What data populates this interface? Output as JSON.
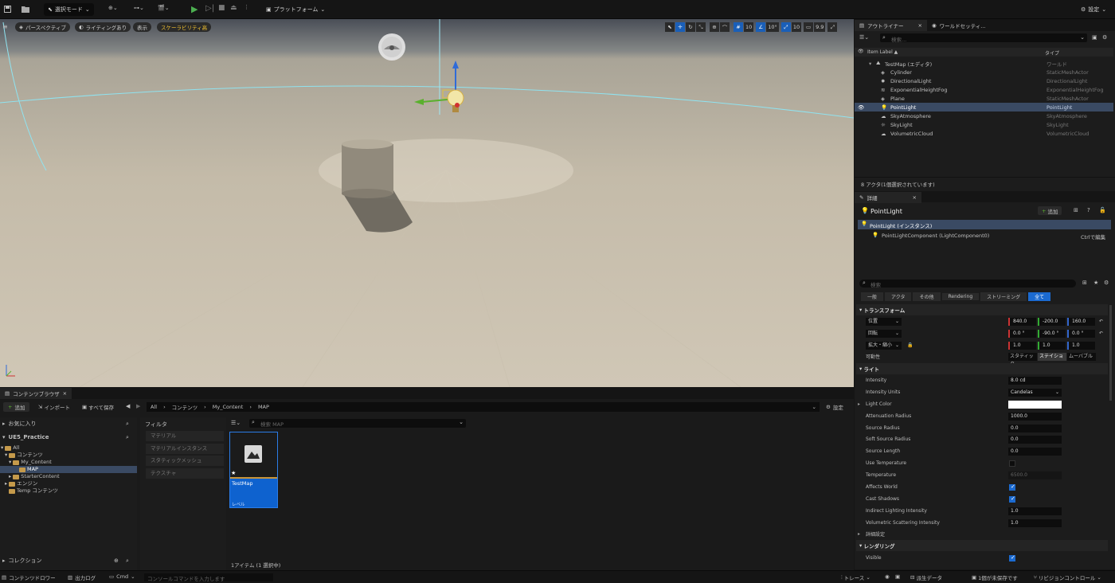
{
  "toolbar": {
    "mode_label": "選択モード",
    "platform_label": "プラットフォーム",
    "settings_label": "設定"
  },
  "viewport": {
    "perspective": "パースペクティブ",
    "lighting": "ライティングあり",
    "show": "表示",
    "scalability": "スケーラビリティ高",
    "grid_snap": "10",
    "rot_snap": "10°",
    "scale_snap": "10",
    "cam_speed": "9.9"
  },
  "outliner": {
    "tab_outliner": "アウトライナー",
    "tab_world": "ワールドセッティ...",
    "search_placeholder": "検索...",
    "col_label": "Item Label ▲",
    "col_type": "タイプ",
    "items": [
      {
        "label": "TestMap (エディタ)",
        "type": "ワールド"
      },
      {
        "label": "Cylinder",
        "type": "StaticMeshActor"
      },
      {
        "label": "DirectionalLight",
        "type": "DirectionalLight"
      },
      {
        "label": "ExponentialHeightFog",
        "type": "ExponentialHeightFog"
      },
      {
        "label": "Plane",
        "type": "StaticMeshActor"
      },
      {
        "label": "PointLight",
        "type": "PointLight"
      },
      {
        "label": "SkyAtmosphere",
        "type": "SkyAtmosphere"
      },
      {
        "label": "SkyLight",
        "type": "SkyLight"
      },
      {
        "label": "VolumetricCloud",
        "type": "VolumetricCloud"
      }
    ],
    "footer": "8 アクタ(1個選択されています)"
  },
  "details": {
    "tab": "詳細",
    "actor_name": "PointLight",
    "add_label": "追加",
    "instance_label": "PointLight (インスタンス)",
    "component_label": "PointLightComponent (LightComponent0)",
    "ctrl_edit": "Ctrlで編集",
    "search_placeholder": "検索",
    "filter_tabs": [
      "一般",
      "アクタ",
      "その他",
      "Rendering",
      "ストリーミング",
      "全て"
    ],
    "transform_section": "トランスフォーム",
    "location_label": "位置",
    "location": [
      "840.0",
      "-200.0",
      "160.0"
    ],
    "rotation_label": "回転",
    "rotation": [
      "0.0 °",
      "-90.0 °",
      "0.0 °"
    ],
    "scale_label": "拡大・縮小",
    "scale": [
      "1.0",
      "1.0",
      "1.0"
    ],
    "mobility_label": "可動性",
    "mobility": [
      "スタティック",
      "ステイショ",
      "ムーバブル"
    ],
    "light_section": "ライト",
    "intensity_label": "Intensity",
    "intensity": "8.0 cd",
    "intensity_units_label": "Intensity Units",
    "intensity_units": "Candelas",
    "light_color_label": "Light Color",
    "attenuation_label": "Attenuation Radius",
    "attenuation": "1000.0",
    "source_radius_label": "Source Radius",
    "source_radius": "0.0",
    "soft_source_radius_label": "Soft Source Radius",
    "soft_source_radius": "0.0",
    "source_length_label": "Source Length",
    "source_length": "0.0",
    "use_temp_label": "Use Temperature",
    "temperature_label": "Temperature",
    "temperature": "6500.0",
    "affects_world_label": "Affects World",
    "cast_shadows_label": "Cast Shadows",
    "indirect_label": "Indirect Lighting Intensity",
    "indirect": "1.0",
    "volumetric_label": "Volumetric Scattering Intensity",
    "volumetric": "1.0",
    "advanced_label": "詳細設定",
    "rendering_section": "レンダリング",
    "visible_label": "Visible"
  },
  "content_browser": {
    "tab": "コンテンツブラウザ",
    "add": "追加",
    "import": "インポート",
    "save_all": "すべて保存",
    "breadcrumb": [
      "All",
      "コンテンツ",
      "My_Content",
      "MAP"
    ],
    "settings": "設定",
    "favorites": "お気に入り",
    "project": "UE5_Practice",
    "tree": [
      "All",
      "コンテンツ",
      "My_Content",
      "MAP",
      "StarterContent",
      "エンジン",
      "Temp コンテンツ"
    ],
    "collections": "コレクション",
    "filter_title": "フィルタ",
    "filters": [
      "マテリアル",
      "マテリアルインスタンス",
      "スタティックメッシュ",
      "テクスチャ"
    ],
    "search_placeholder": "検索 MAP",
    "asset_name": "TestMap",
    "asset_type": "レベル",
    "item_count": "1アイテム (1 選択中)"
  },
  "statusbar": {
    "content_drawer": "コンテンツドロワー",
    "output_log": "出力ログ",
    "cmd": "Cmd",
    "console_placeholder": "コンソールコマンドを入力します",
    "trace": "トレース",
    "derived_data": "派生データ",
    "unsaved": "1個が未保存です",
    "revision": "リビジョンコントロール"
  }
}
